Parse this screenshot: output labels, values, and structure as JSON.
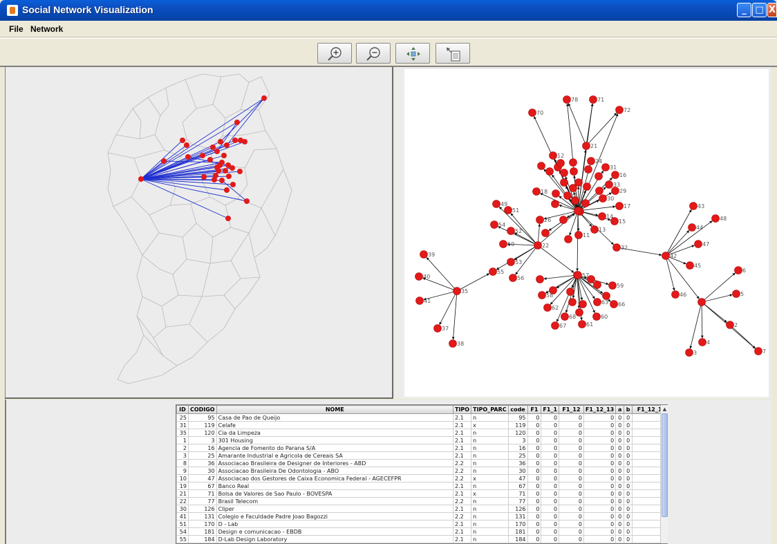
{
  "window": {
    "title": "Social Network Visualization",
    "controls": [
      "_",
      "□",
      "X"
    ]
  },
  "menu": [
    "File",
    "Network"
  ],
  "toolbar": {
    "buttons": [
      "zoom-in-icon",
      "zoom-out-icon",
      "pan-icon",
      "select-table-icon"
    ]
  },
  "colors": {
    "node": "#e21a1a",
    "geo_edge": "#1f2fd0",
    "net_edge": "#111111",
    "map_border": "#b9b9b9",
    "node_label": "#555555"
  },
  "graph_nodes": [
    {
      "id": "78"
    },
    {
      "id": "71"
    },
    {
      "id": "72"
    },
    {
      "id": "70"
    },
    {
      "id": "21"
    },
    {
      "id": "12"
    },
    {
      "id": "24"
    },
    {
      "id": "31"
    },
    {
      "id": "16"
    },
    {
      "id": "33"
    },
    {
      "id": "29"
    },
    {
      "id": "30"
    },
    {
      "id": "17"
    },
    {
      "id": "14"
    },
    {
      "id": "15"
    },
    {
      "id": "13"
    },
    {
      "id": "11"
    },
    {
      "id": "18"
    },
    {
      "id": "49"
    },
    {
      "id": "51"
    },
    {
      "id": "54"
    },
    {
      "id": "52"
    },
    {
      "id": "50"
    },
    {
      "id": "53"
    },
    {
      "id": "26"
    },
    {
      "id": "22"
    },
    {
      "id": "32"
    },
    {
      "id": "42"
    },
    {
      "id": "43"
    },
    {
      "id": "48"
    },
    {
      "id": "44"
    },
    {
      "id": "47"
    },
    {
      "id": "45"
    },
    {
      "id": "46"
    },
    {
      "id": "6"
    },
    {
      "id": "5"
    },
    {
      "id": "2"
    },
    {
      "id": "4"
    },
    {
      "id": "3"
    },
    {
      "id": "7"
    },
    {
      "id": "39"
    },
    {
      "id": "40"
    },
    {
      "id": "41"
    },
    {
      "id": "37"
    },
    {
      "id": "38"
    },
    {
      "id": "35"
    },
    {
      "id": "55"
    },
    {
      "id": "56"
    },
    {
      "id": "57"
    },
    {
      "id": "59"
    },
    {
      "id": "66"
    },
    {
      "id": "60"
    },
    {
      "id": "61"
    },
    {
      "id": "67"
    },
    {
      "id": "68"
    },
    {
      "id": "58"
    },
    {
      "id": "62"
    },
    {
      "id": "63"
    }
  ],
  "table": {
    "columns": [
      "ID",
      "CODIGO",
      "NOME",
      "TIPO",
      "TIPO_PARC",
      "code",
      "F1",
      "F1_1",
      "F1_12",
      "F1_12_13",
      "a",
      "b",
      "F1_12_1"
    ],
    "rows": [
      [
        "25",
        "95",
        "Casa de Pao de Queijo",
        "2.1",
        "n",
        "95",
        "0",
        "0",
        "0",
        "0",
        "0",
        "0",
        ""
      ],
      [
        "31",
        "119",
        "Celafe",
        "2.1",
        "x",
        "119",
        "0",
        "0",
        "0",
        "0",
        "0",
        "0",
        ""
      ],
      [
        "35",
        "120",
        "Cia da Limpeza",
        "2.1",
        "n",
        "120",
        "0",
        "0",
        "0",
        "0",
        "0",
        "0",
        ""
      ],
      [
        "1",
        "3",
        "301 Housing",
        "2.1",
        "n",
        "3",
        "0",
        "0",
        "0",
        "0",
        "0",
        "0",
        ""
      ],
      [
        "2",
        "16",
        "Agencia de Fomento do Parana S/A",
        "2.1",
        "n",
        "16",
        "0",
        "0",
        "0",
        "0",
        "0",
        "0",
        ""
      ],
      [
        "3",
        "25",
        "Amarante Industrial e Agricola de Cereais SA",
        "2.1",
        "n",
        "25",
        "0",
        "0",
        "0",
        "0",
        "0",
        "0",
        ""
      ],
      [
        "8",
        "36",
        "Associacao Brasileira de Designer de Interiores - ABD",
        "2.2",
        "n",
        "36",
        "0",
        "0",
        "0",
        "0",
        "0",
        "0",
        ""
      ],
      [
        "9",
        "30",
        "Associacao Brasileira De Odontologia - ABO",
        "2.2",
        "n",
        "30",
        "0",
        "0",
        "0",
        "0",
        "0",
        "0",
        ""
      ],
      [
        "10",
        "47",
        "Associacao dos Gestores de Caixa Economica Federal - AGECEFPR",
        "2.2",
        "x",
        "47",
        "0",
        "0",
        "0",
        "0",
        "0",
        "0",
        ""
      ],
      [
        "19",
        "67",
        "Banco Real",
        "2.1",
        "n",
        "67",
        "0",
        "0",
        "0",
        "0",
        "0",
        "0",
        ""
      ],
      [
        "21",
        "71",
        "Bolsa de Valores de Sao Paulo - BOVESPA",
        "2.1",
        "x",
        "71",
        "0",
        "0",
        "0",
        "0",
        "0",
        "0",
        ""
      ],
      [
        "22",
        "77",
        "Brasil Telecom",
        "2.2",
        "n",
        "77",
        "0",
        "0",
        "0",
        "0",
        "0",
        "0",
        ""
      ],
      [
        "30",
        "126",
        "Cliper",
        "2.1",
        "n",
        "126",
        "0",
        "0",
        "0",
        "0",
        "0",
        "0",
        ""
      ],
      [
        "41",
        "131",
        "Colegio e Faculdade Padre Joao Bagozzi",
        "2.2",
        "n",
        "131",
        "0",
        "0",
        "0",
        "0",
        "0",
        "0",
        ""
      ],
      [
        "51",
        "170",
        "D - Lab",
        "2.1",
        "n",
        "170",
        "0",
        "0",
        "0",
        "0",
        "0",
        "0",
        ""
      ],
      [
        "54",
        "181",
        "Design e comunicacao - EBDB",
        "2.1",
        "n",
        "181",
        "0",
        "0",
        "0",
        "0",
        "0",
        "0",
        ""
      ],
      [
        "55",
        "184",
        "D-Lab Design Laboratory",
        "2.1",
        "n",
        "184",
        "0",
        "0",
        "0",
        "0",
        "0",
        "0",
        ""
      ]
    ]
  }
}
